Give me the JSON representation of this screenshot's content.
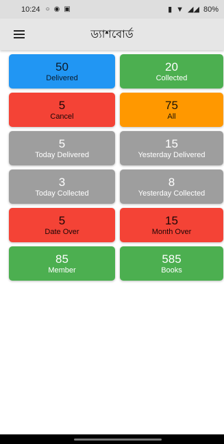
{
  "status_bar": {
    "time": "10:24",
    "battery": "80%"
  },
  "app_bar": {
    "title": "ড্যাশবোর্ড"
  },
  "cards": [
    {
      "value": "50",
      "label": "Delivered",
      "bg": "#2196f3",
      "fg": "#0b1a2a"
    },
    {
      "value": "20",
      "label": "Collected",
      "bg": "#4caf50",
      "fg": "#ffffff"
    },
    {
      "value": "5",
      "label": "Cancel",
      "bg": "#f44336",
      "fg": "#1a0606"
    },
    {
      "value": "75",
      "label": "All",
      "bg": "#ff9800",
      "fg": "#1a1206"
    },
    {
      "value": "5",
      "label": "Today Delivered",
      "bg": "#9e9e9e",
      "fg": "#ffffff"
    },
    {
      "value": "15",
      "label": "Yesterday Delivered",
      "bg": "#9e9e9e",
      "fg": "#ffffff"
    },
    {
      "value": "3",
      "label": "Today Collected",
      "bg": "#9e9e9e",
      "fg": "#ffffff"
    },
    {
      "value": "8",
      "label": "Yesterday Collected",
      "bg": "#9e9e9e",
      "fg": "#ffffff"
    },
    {
      "value": "5",
      "label": "Date Over",
      "bg": "#f44336",
      "fg": "#1a0606"
    },
    {
      "value": "15",
      "label": "Month Over",
      "bg": "#f44336",
      "fg": "#1a0606"
    },
    {
      "value": "85",
      "label": "Member",
      "bg": "#4caf50",
      "fg": "#ffffff"
    },
    {
      "value": "585",
      "label": "Books",
      "bg": "#4caf50",
      "fg": "#ffffff"
    }
  ]
}
